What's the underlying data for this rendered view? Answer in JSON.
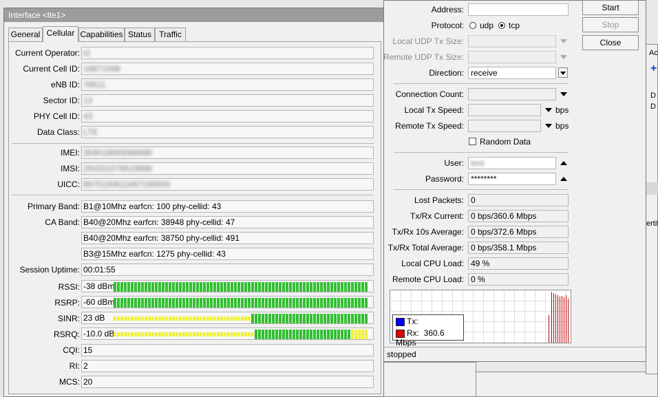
{
  "interface": {
    "title": "Interface <lte1>",
    "tabs": [
      {
        "label": "General",
        "active": false
      },
      {
        "label": "Cellular",
        "active": true
      },
      {
        "label": "Capabilities",
        "active": false
      },
      {
        "label": "Status",
        "active": false
      },
      {
        "label": "Traffic",
        "active": false
      }
    ],
    "fields": {
      "current_operator": {
        "label": "Current Operator:",
        "value": "t2"
      },
      "current_cell_id": {
        "label": "Current Cell ID:",
        "value": "18871598"
      },
      "enb_id": {
        "label": "eNB ID:",
        "value": "78511"
      },
      "sector_id": {
        "label": "Sector ID:",
        "value": "13"
      },
      "phy_cell_id": {
        "label": "PHY Cell ID:",
        "value": "43"
      },
      "data_class": {
        "label": "Data Class:",
        "value": "LTE"
      },
      "imei": {
        "label": "IMEI:",
        "value": "359018893088690"
      },
      "imsi": {
        "label": "IMSI:",
        "value": "250201078519898"
      },
      "uicc": {
        "label": "UICC:",
        "value": "8970100611697180693"
      },
      "primary_band": {
        "label": "Primary Band:",
        "value": "B1@10Mhz earfcn: 100 phy-cellid: 43"
      },
      "ca_band": {
        "label": "CA Band:",
        "values": [
          "B40@20Mhz earfcn: 38948 phy-cellid: 47",
          "B40@20Mhz earfcn: 38750 phy-cellid: 491",
          "B3@15Mhz earfcn: 1275 phy-cellid: 43"
        ]
      },
      "session_uptime": {
        "label": "Session Uptime:",
        "value": "00:01:55"
      },
      "rssi": {
        "label": "RSSI:",
        "value": "-38 dBm",
        "level": 1.0
      },
      "rsrp": {
        "label": "RSRP:",
        "value": "-60 dBm",
        "level": 1.0
      },
      "sinr": {
        "label": "SINR:",
        "value": "23 dB",
        "level": 0.46
      },
      "rsrq": {
        "label": "RSRQ:",
        "value": "-10.0 dB",
        "level": 0.45
      },
      "cqi": {
        "label": "CQI:",
        "value": "15"
      },
      "ri": {
        "label": "RI:",
        "value": "2"
      },
      "mcs": {
        "label": "MCS:",
        "value": "20"
      }
    },
    "bar_colors": {
      "good": "#33c033",
      "weak": "#f0f03c"
    }
  },
  "btest": {
    "address": {
      "label": "Address:",
      "value": ""
    },
    "protocol": {
      "label": "Protocol:",
      "udp": "udp",
      "tcp": "tcp",
      "selected": "tcp"
    },
    "local_udp": {
      "label": "Local UDP Tx Size:"
    },
    "remote_udp": {
      "label": "Remote UDP Tx Size:"
    },
    "direction": {
      "label": "Direction:",
      "value": "receive"
    },
    "connection_count": {
      "label": "Connection Count:"
    },
    "local_tx_speed": {
      "label": "Local Tx Speed:",
      "unit": "bps"
    },
    "remote_tx_speed": {
      "label": "Remote Tx Speed:",
      "unit": "bps"
    },
    "random_data": {
      "label": "Random Data"
    },
    "user": {
      "label": "User:",
      "value": "test"
    },
    "password": {
      "label": "Password:",
      "value": "********"
    },
    "lost_packets": {
      "label": "Lost Packets:",
      "value": "0"
    },
    "txrx_current": {
      "label": "Tx/Rx Current:",
      "value": "0 bps/360.6 Mbps"
    },
    "txrx_10s": {
      "label": "Tx/Rx 10s Average:",
      "value": "0 bps/372.6 Mbps"
    },
    "txrx_total": {
      "label": "Tx/Rx Total Average:",
      "value": "0 bps/358.1 Mbps"
    },
    "local_cpu": {
      "label": "Local CPU Load:",
      "value": "49 %"
    },
    "remote_cpu": {
      "label": "Remote CPU Load:",
      "value": "0 %"
    },
    "buttons": {
      "start": "Start",
      "stop": "Stop",
      "close": "Close"
    },
    "legend": {
      "tx_label": "Tx:",
      "tx_value": "",
      "rx_label": "Rx:",
      "rx_value": "360.6 Mbps",
      "tx_color": "#0000ff",
      "rx_color": "#e00000"
    },
    "status": "stopped"
  },
  "background": {
    "right_fragments": {
      "ac": "Ac",
      "d1": "D",
      "d2": "D",
      "ertif": "ertif"
    }
  }
}
